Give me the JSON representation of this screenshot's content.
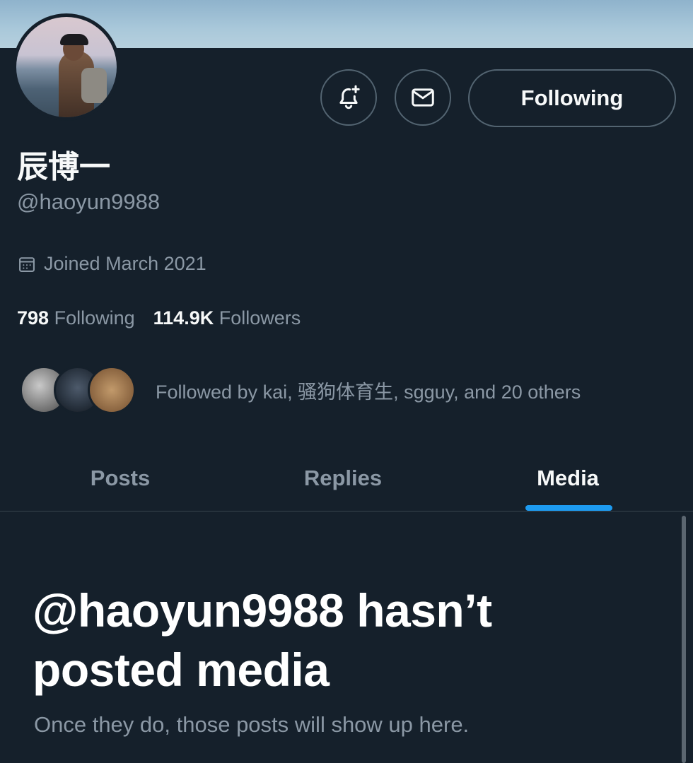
{
  "profile": {
    "display_name": "辰博一",
    "handle": "@haoyun9988",
    "joined": "Joined March 2021",
    "following_count": "798",
    "following_label": "Following",
    "followers_count": "114.9K",
    "followers_label": "Followers",
    "followed_by": "Followed by kai, 骚狗体育生, sgguy, and 20 others"
  },
  "actions": {
    "notify_icon": "bell-plus-icon",
    "message_icon": "envelope-icon",
    "follow_label": "Following"
  },
  "tabs": [
    {
      "label": "Posts",
      "active": false
    },
    {
      "label": "Replies",
      "active": false
    },
    {
      "label": "Media",
      "active": true
    }
  ],
  "empty_state": {
    "title": "@haoyun9988 hasn’t posted media",
    "subtitle": "Once they do, those posts will show up here."
  },
  "colors": {
    "background": "#15202b",
    "accent": "#1d9bf0",
    "muted_text": "#8b98a5",
    "border": "#536471"
  }
}
